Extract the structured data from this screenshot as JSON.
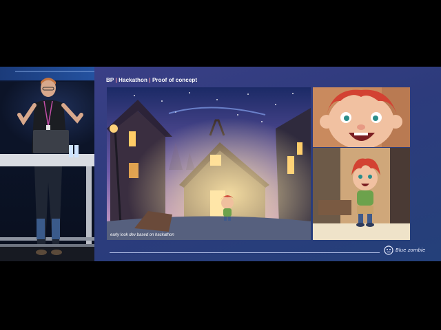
{
  "slide": {
    "title_parts": [
      "BP",
      "Hackathon",
      "Proof of concept"
    ],
    "separator": "|",
    "caption": "early look dev based on hackathon",
    "logo_text": "Blue zombie"
  },
  "colors": {
    "slide_bg": "#2e3c7e",
    "title_text": "#ffffff",
    "separator": "#ff9aa8"
  }
}
